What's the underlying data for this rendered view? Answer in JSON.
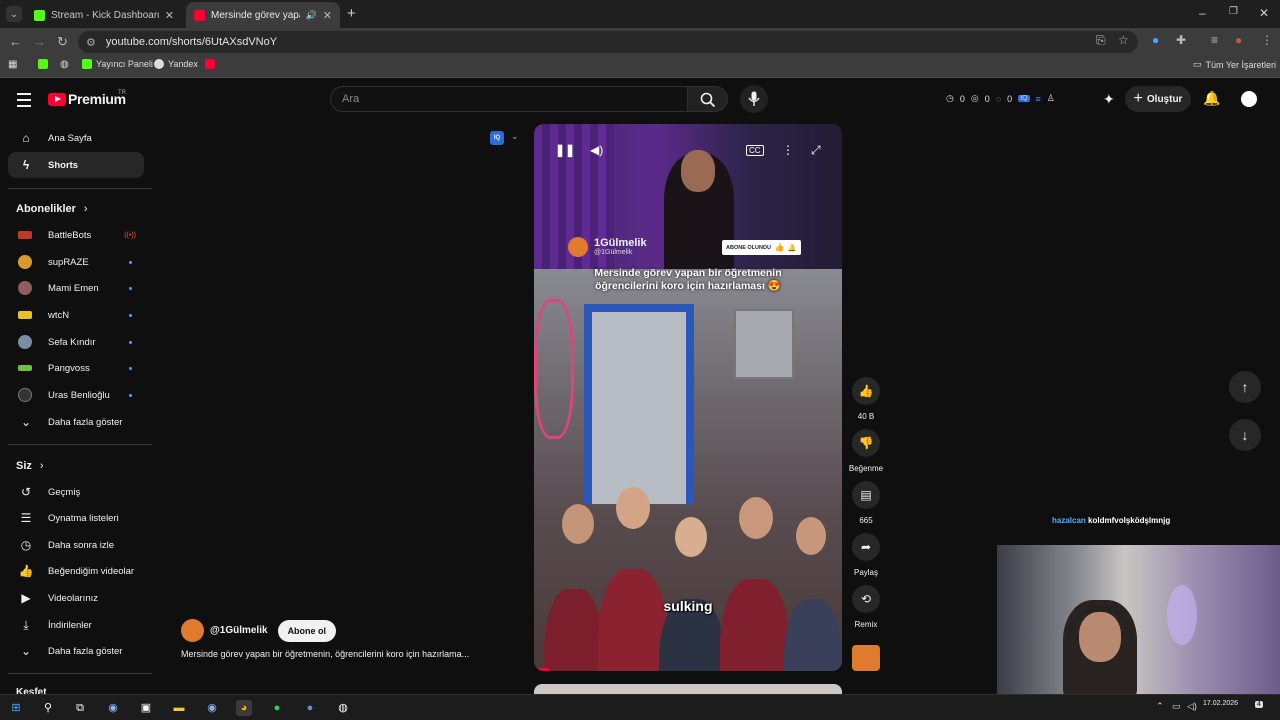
{
  "browser": {
    "tabs": [
      {
        "title": "Stream - Kick Dashboard",
        "active": false
      },
      {
        "title": "Mersinde görev yapan bir ö",
        "active": true
      }
    ],
    "url": "youtube.com/shorts/6UtAXsdVNoY",
    "bookmarks": [
      "Yayıncı Paneli",
      "Yandex"
    ],
    "all_bookmarks": "Tüm Yer İşaretleri"
  },
  "header": {
    "logo": "Premium",
    "region": "TR",
    "search_placeholder": "Ara",
    "counters": [
      "0",
      "0",
      "0"
    ],
    "create_label": "Oluştur"
  },
  "sidebar": {
    "main": [
      {
        "label": "Ana Sayfa",
        "icon": "home-icon"
      },
      {
        "label": "Shorts",
        "icon": "shorts-icon",
        "active": true
      }
    ],
    "subscriptions_title": "Abonelikler",
    "subscriptions": [
      {
        "label": "BattleBots",
        "status": "live",
        "color": "#c0392b"
      },
      {
        "label": "supRAZE",
        "status": "dot",
        "color": "#d89b2a"
      },
      {
        "label": "Mami Emen",
        "status": "dot",
        "color": "#8e5d5d"
      },
      {
        "label": "wtcN",
        "status": "dot",
        "color": "#e6c228"
      },
      {
        "label": "Sefa Kındır",
        "status": "dot",
        "color": "#7b8ca3"
      },
      {
        "label": "Pangvoss",
        "status": "dot",
        "color": "#6fbf3a"
      },
      {
        "label": "Uras Benlioğlu",
        "status": "dot",
        "color": "#333333"
      }
    ],
    "show_more_1": "Daha fazla göster",
    "you_title": "Siz",
    "you": [
      {
        "label": "Geçmiş",
        "icon": "history-icon"
      },
      {
        "label": "Oynatma listeleri",
        "icon": "playlists-icon"
      },
      {
        "label": "Daha sonra izle",
        "icon": "watch-later-icon"
      },
      {
        "label": "Beğendiğim videolar",
        "icon": "liked-videos-icon"
      },
      {
        "label": "Videolarınız",
        "icon": "your-videos-icon"
      },
      {
        "label": "İndirilenler",
        "icon": "downloads-icon"
      }
    ],
    "show_more_2": "Daha fazla göster",
    "explore_title": "Keşfet"
  },
  "short": {
    "channel_name": "1Gülmelik",
    "channel_handle": "@1Gülmelik",
    "subscribed_overlay": "ABONE OLUNDU",
    "caption_line1": "Mersinde görev yapan bir öğretmenin",
    "caption_line2": "öğrencilerini koro için hazırlaması 😍",
    "subtitle": "sulking",
    "progress": 0.05
  },
  "actions": {
    "like_count": "40 B",
    "dislike_label": "Beğenme",
    "comment_count": "665",
    "share_label": "Paylaş",
    "remix_label": "Remix"
  },
  "below": {
    "channel": "@1Gülmelik",
    "subscribe_label": "Abone ol",
    "description": "Mersinde görev yapan bir öğretmenin, öğrencilerini koro için hazırlama..."
  },
  "chat": {
    "user": "hazalcan",
    "message": "koldmfvolşködşlmnjg"
  },
  "taskbar": {
    "date": "17.02.2026",
    "notifications": "4"
  },
  "colors": {
    "brand": "#ff0033",
    "background": "#0f0f0f",
    "accent": "#3ea6ff"
  }
}
